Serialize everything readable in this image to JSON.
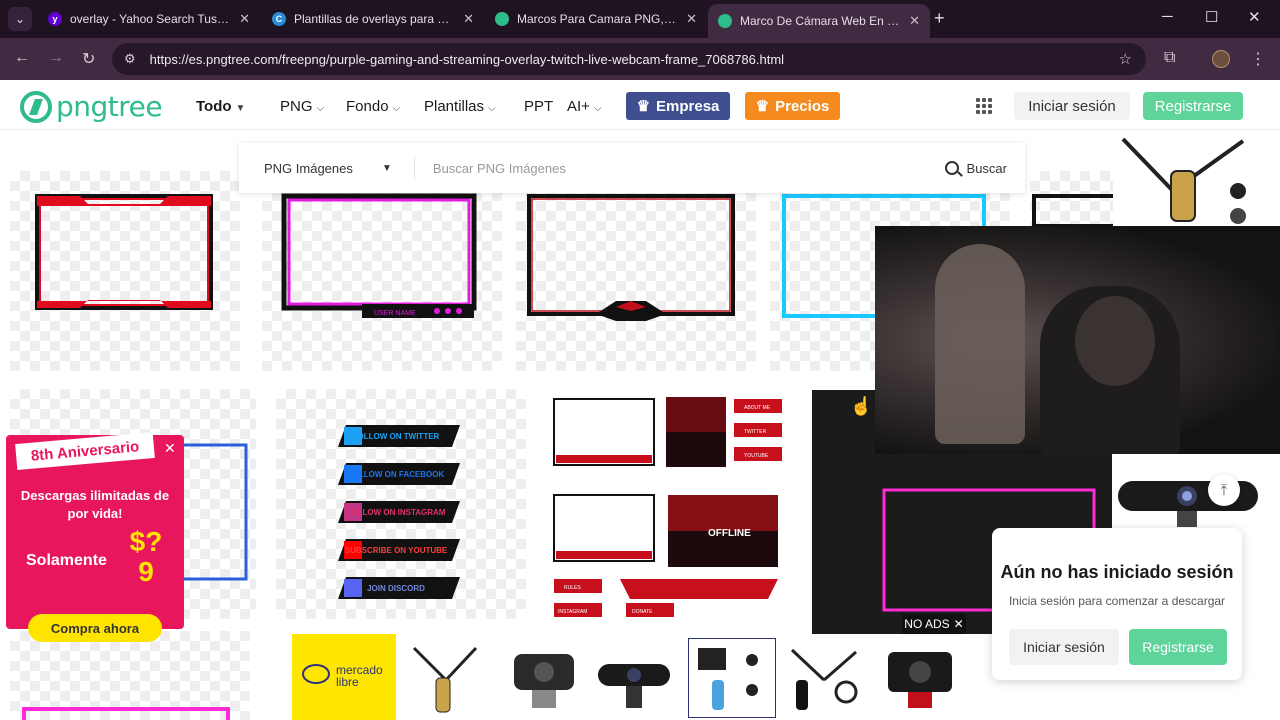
{
  "browser": {
    "tabs": [
      {
        "title": "overlay - Yahoo Search Tus resultados",
        "favicon": "yahoo-icon",
        "color": "#6001d2",
        "glyph": "y",
        "active": false
      },
      {
        "title": "Plantillas de overlays para Twitch",
        "favicon": "canva-icon",
        "color": "#2a8bd8",
        "glyph": "C",
        "active": false
      },
      {
        "title": "Marcos Para Camara PNG, Dibujos",
        "favicon": "pngtree-icon",
        "color": "#2ebd8a",
        "glyph": "",
        "active": false
      },
      {
        "title": "Marco De Cámara Web En Vivo",
        "favicon": "pngtree-icon",
        "color": "#2ebd8a",
        "glyph": "",
        "active": true
      }
    ],
    "url": "https://es.pngtree.com/freepng/purple-gaming-and-streaming-overlay-twitch-live-webcam-frame_7068786.html",
    "theme_colors": {
      "tabbar": "#1f1322",
      "toolbar": "#402b43"
    }
  },
  "site": {
    "logo_text": "pngtree",
    "brand_color": "#2ebd8a",
    "nav": {
      "todo": "Todo",
      "png": "PNG",
      "fondo": "Fondo",
      "plantillas": "Plantillas",
      "ppt": "PPT",
      "ai": "AI+"
    },
    "empresa_label": "Empresa",
    "precios_label": "Precios",
    "login_label": "Iniciar sesión",
    "register_label": "Registrarse"
  },
  "search": {
    "category": "PNG Imágenes",
    "placeholder": "Buscar PNG Imágenes",
    "button": "Buscar"
  },
  "thumbnails": {
    "frame2_small": "USER NAME",
    "social_buttons": [
      "FOLLOW ON TWITTER",
      "FOLLOW ON FACEBOOK",
      "FOLLOW ON INSTAGRAM",
      "SUBSCRIBE ON YOUTUBE",
      "JOIN DISCORD"
    ],
    "kit_labels": [
      "ABOUT ME",
      "TWITTER",
      "YOUTUBE",
      "RULES",
      "INSTAGRAM",
      "DONATE"
    ],
    "kit_offline": "OFFLINE"
  },
  "promo": {
    "badge": "8th Aniversario",
    "desc": "Descargas ilimitadas de por vida!",
    "only": "Solamente",
    "price": "$?9",
    "cta": "Compra ahora",
    "color": "#e8175d"
  },
  "login_popup": {
    "title": "Aún no has iniciado sesión",
    "subtitle": "Inicia sesión para comenzar a descargar",
    "login": "Iniciar sesión",
    "register": "Registrarse"
  },
  "ad": {
    "brand": "mercado libre",
    "no_ads": "NO ADS",
    "products": [
      "mic-arm-gold",
      "webcam-1",
      "webcam-2",
      "mic-kit",
      "mic-arm-black",
      "webcam-red"
    ]
  }
}
